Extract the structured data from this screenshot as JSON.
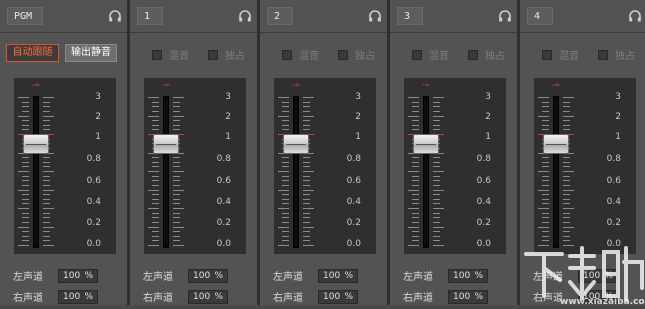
{
  "channels": [
    {
      "label": "PGM",
      "type": "master",
      "auto_follow": "自动跟随",
      "output_mute": "输出静音",
      "level": 1.0,
      "volumes": [
        {
          "label": "左声道",
          "value": "100",
          "unit": "%"
        },
        {
          "label": "右声道",
          "value": "100",
          "unit": "%"
        }
      ]
    },
    {
      "label": "1",
      "type": "input",
      "mute": "混音",
      "solo": "独占",
      "level": 1.0,
      "volumes": [
        {
          "label": "左声道",
          "value": "100",
          "unit": "%"
        },
        {
          "label": "右声道",
          "value": "100",
          "unit": "%"
        }
      ]
    },
    {
      "label": "2",
      "type": "input",
      "mute": "混音",
      "solo": "独占",
      "level": 1.0,
      "volumes": [
        {
          "label": "左声道",
          "value": "100",
          "unit": "%"
        },
        {
          "label": "右声道",
          "value": "100",
          "unit": "%"
        }
      ]
    },
    {
      "label": "3",
      "type": "input",
      "mute": "混音",
      "solo": "独占",
      "level": 1.0,
      "volumes": [
        {
          "label": "左声道",
          "value": "100",
          "unit": "%"
        },
        {
          "label": "右声道",
          "value": "100",
          "unit": "%"
        }
      ]
    },
    {
      "label": "4",
      "type": "input",
      "mute": "混音",
      "solo": "独占",
      "level": 1.0,
      "volumes": [
        {
          "label": "左声道",
          "value": "100",
          "unit": "%"
        },
        {
          "label": "右声道",
          "value": "100",
          "unit": "%"
        }
      ]
    }
  ],
  "scale_labels": [
    "3",
    "2",
    "1",
    "0.8",
    "0.6",
    "0.4",
    "0.2",
    "0.0"
  ],
  "peak_text": "-∞",
  "watermark": "下载吧",
  "colors": {
    "accent": "#d9532c",
    "peak": "#d9473d",
    "strip": "#535353",
    "panel": "#2f2f2f"
  },
  "icons": {
    "headphone": "headphone-icon"
  }
}
